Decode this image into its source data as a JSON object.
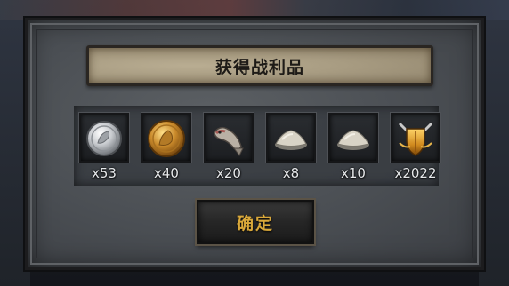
{
  "dialog": {
    "title": "获得战利品",
    "confirm_label": "确定"
  },
  "rewards": [
    {
      "icon": "silver-coin-icon",
      "quantity": "x53"
    },
    {
      "icon": "gold-coin-icon",
      "quantity": "x40"
    },
    {
      "icon": "fish-icon",
      "quantity": "x20"
    },
    {
      "icon": "salt-pile-icon",
      "quantity": "x8"
    },
    {
      "icon": "salt-pile-icon",
      "quantity": "x10"
    },
    {
      "icon": "shield-crest-icon",
      "quantity": "x2022"
    }
  ],
  "colors": {
    "confirm_text": "#d9a83a",
    "banner": "#a89c82",
    "panel": "#4a4e53"
  }
}
